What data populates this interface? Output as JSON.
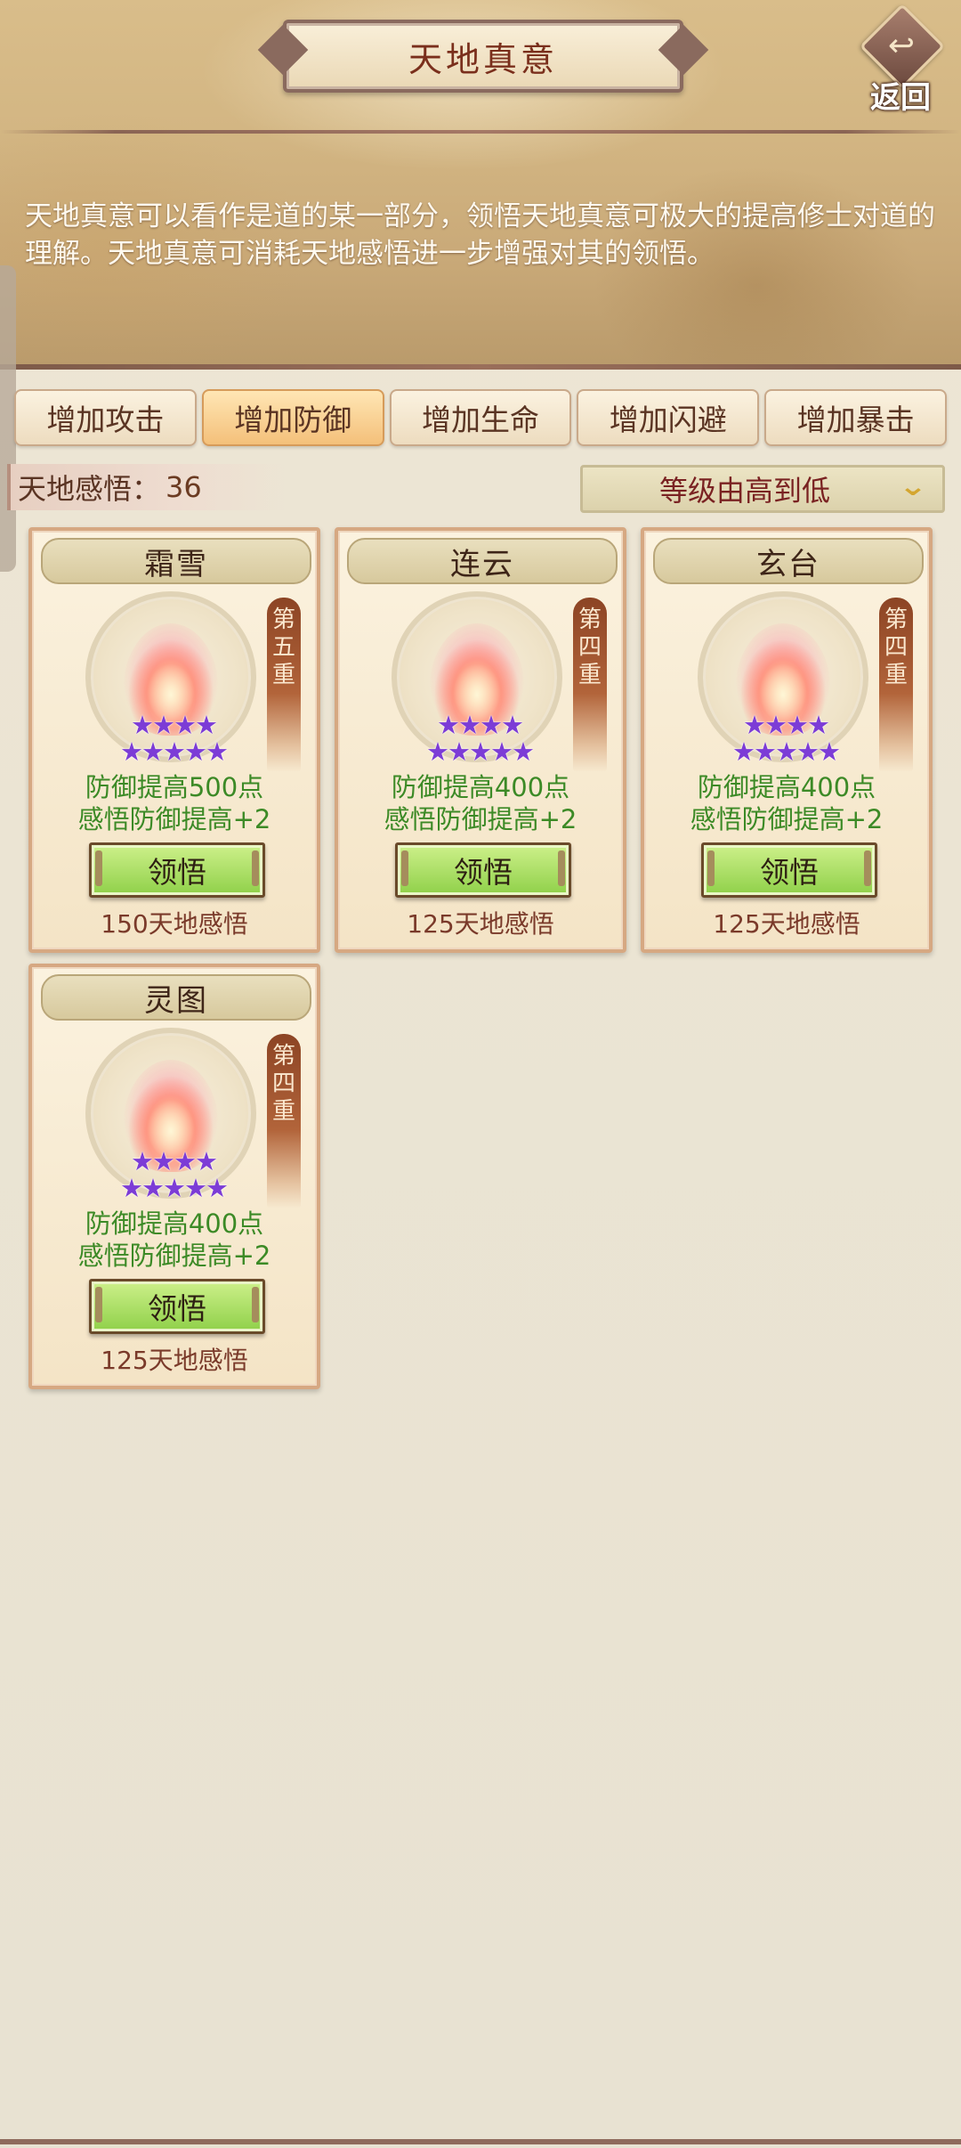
{
  "header": {
    "title": "天地真意",
    "back_label": "返回",
    "description": "天地真意可以看作是道的某一部分，领悟天地真意可极大的提高修士对道的理解。天地真意可消耗天地感悟进一步增强对其的领悟。"
  },
  "tabs": [
    {
      "label": "增加攻击",
      "active": false
    },
    {
      "label": "增加防御",
      "active": true
    },
    {
      "label": "增加生命",
      "active": false
    },
    {
      "label": "增加闪避",
      "active": false
    },
    {
      "label": "增加暴击",
      "active": false
    }
  ],
  "insight": {
    "label": "天地感悟：",
    "count": "36"
  },
  "sort": {
    "label": "等级由高到低"
  },
  "cards": [
    {
      "name": "霜雪",
      "tier": [
        "第",
        "五",
        "重"
      ],
      "stars": 9,
      "effect1": "防御提高500点",
      "effect2": "感悟防御提高+2",
      "button": "领悟",
      "cost": "150天地感悟"
    },
    {
      "name": "连云",
      "tier": [
        "第",
        "四",
        "重"
      ],
      "stars": 9,
      "effect1": "防御提高400点",
      "effect2": "感悟防御提高+2",
      "button": "领悟",
      "cost": "125天地感悟"
    },
    {
      "name": "玄台",
      "tier": [
        "第",
        "四",
        "重"
      ],
      "stars": 9,
      "effect1": "防御提高400点",
      "effect2": "感悟防御提高+2",
      "button": "领悟",
      "cost": "125天地感悟"
    },
    {
      "name": "灵图",
      "tier": [
        "第",
        "四",
        "重"
      ],
      "stars": 9,
      "effect1": "防御提高400点",
      "effect2": "感悟防御提高+2",
      "button": "领悟",
      "cost": "125天地感悟"
    }
  ],
  "colors": {
    "accent_tab": "#f4c07a",
    "button_green": "#8fd049",
    "star_purple": "#7c3cd6",
    "effect_green": "#3c8a26"
  }
}
